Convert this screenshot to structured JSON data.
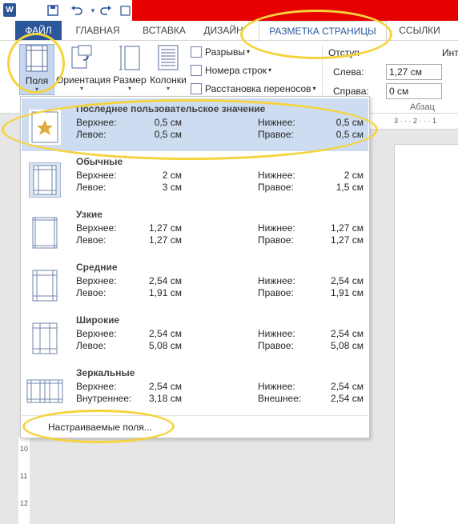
{
  "titlebar": {
    "app_icon": "W",
    "quick_access": [
      "save-icon",
      "undo-icon",
      "redo-icon",
      "checkbox-icon",
      "customize-icon"
    ]
  },
  "tabs": [
    {
      "label": "ФАЙЛ"
    },
    {
      "label": "ГЛАВНАЯ"
    },
    {
      "label": "ВСТАВКА"
    },
    {
      "label": "ДИЗАЙН"
    },
    {
      "label": "РАЗМЕТКА СТРАНИЦЫ"
    },
    {
      "label": "ССЫЛКИ"
    }
  ],
  "ribbon": {
    "margins_label": "Поля",
    "orientation_label": "Ориентация",
    "size_label": "Размер",
    "columns_label": "Колонки",
    "breaks_label": "Разрывы",
    "line_numbers_label": "Номера строк",
    "hyphenation_label": "Расстановка переносов",
    "indent_title": "Отступ",
    "left_label": "Слева:",
    "left_value": "1,27 см",
    "right_label": "Справа:",
    "right_value": "0 см",
    "spacing_title_partial": "Инт",
    "paragraph_group": "Абзац"
  },
  "margins_menu": {
    "options": [
      {
        "title": "Последнее пользовательское значение",
        "top_label": "Верхнее:",
        "top": "0,5 см",
        "bottom_label": "Нижнее:",
        "bottom": "0,5 см",
        "left_label": "Левое:",
        "left": "0,5 см",
        "right_label": "Правое:",
        "right": "0,5 см"
      },
      {
        "title": "Обычные",
        "top_label": "Верхнее:",
        "top": "2 см",
        "bottom_label": "Нижнее:",
        "bottom": "2 см",
        "left_label": "Левое:",
        "left": "3 см",
        "right_label": "Правое:",
        "right": "1,5 см"
      },
      {
        "title": "Узкие",
        "top_label": "Верхнее:",
        "top": "1,27 см",
        "bottom_label": "Нижнее:",
        "bottom": "1,27 см",
        "left_label": "Левое:",
        "left": "1,27 см",
        "right_label": "Правое:",
        "right": "1,27 см"
      },
      {
        "title": "Средние",
        "top_label": "Верхнее:",
        "top": "2,54 см",
        "bottom_label": "Нижнее:",
        "bottom": "2,54 см",
        "left_label": "Левое:",
        "left": "1,91 см",
        "right_label": "Правое:",
        "right": "1,91 см"
      },
      {
        "title": "Широкие",
        "top_label": "Верхнее:",
        "top": "2,54 см",
        "bottom_label": "Нижнее:",
        "bottom": "2,54 см",
        "left_label": "Левое:",
        "left": "5,08 см",
        "right_label": "Правое:",
        "right": "5,08 см"
      },
      {
        "title": "Зеркальные",
        "top_label": "Верхнее:",
        "top": "2,54 см",
        "bottom_label": "Нижнее:",
        "bottom": "2,54 см",
        "left_label": "Внутреннее:",
        "left": "3,18 см",
        "right_label": "Внешнее:",
        "right": "2,54 см"
      }
    ],
    "custom_label": "Настраиваемые поля..."
  },
  "ruler": {
    "top_ticks": "3 · · · 2 · · · 1",
    "left_ticks": [
      "10",
      "11",
      "12"
    ]
  },
  "colors": {
    "accent": "#2b579a",
    "selected_bg": "#cddcf0",
    "highlight": "#f5d33c",
    "title_red": "#e60000"
  }
}
